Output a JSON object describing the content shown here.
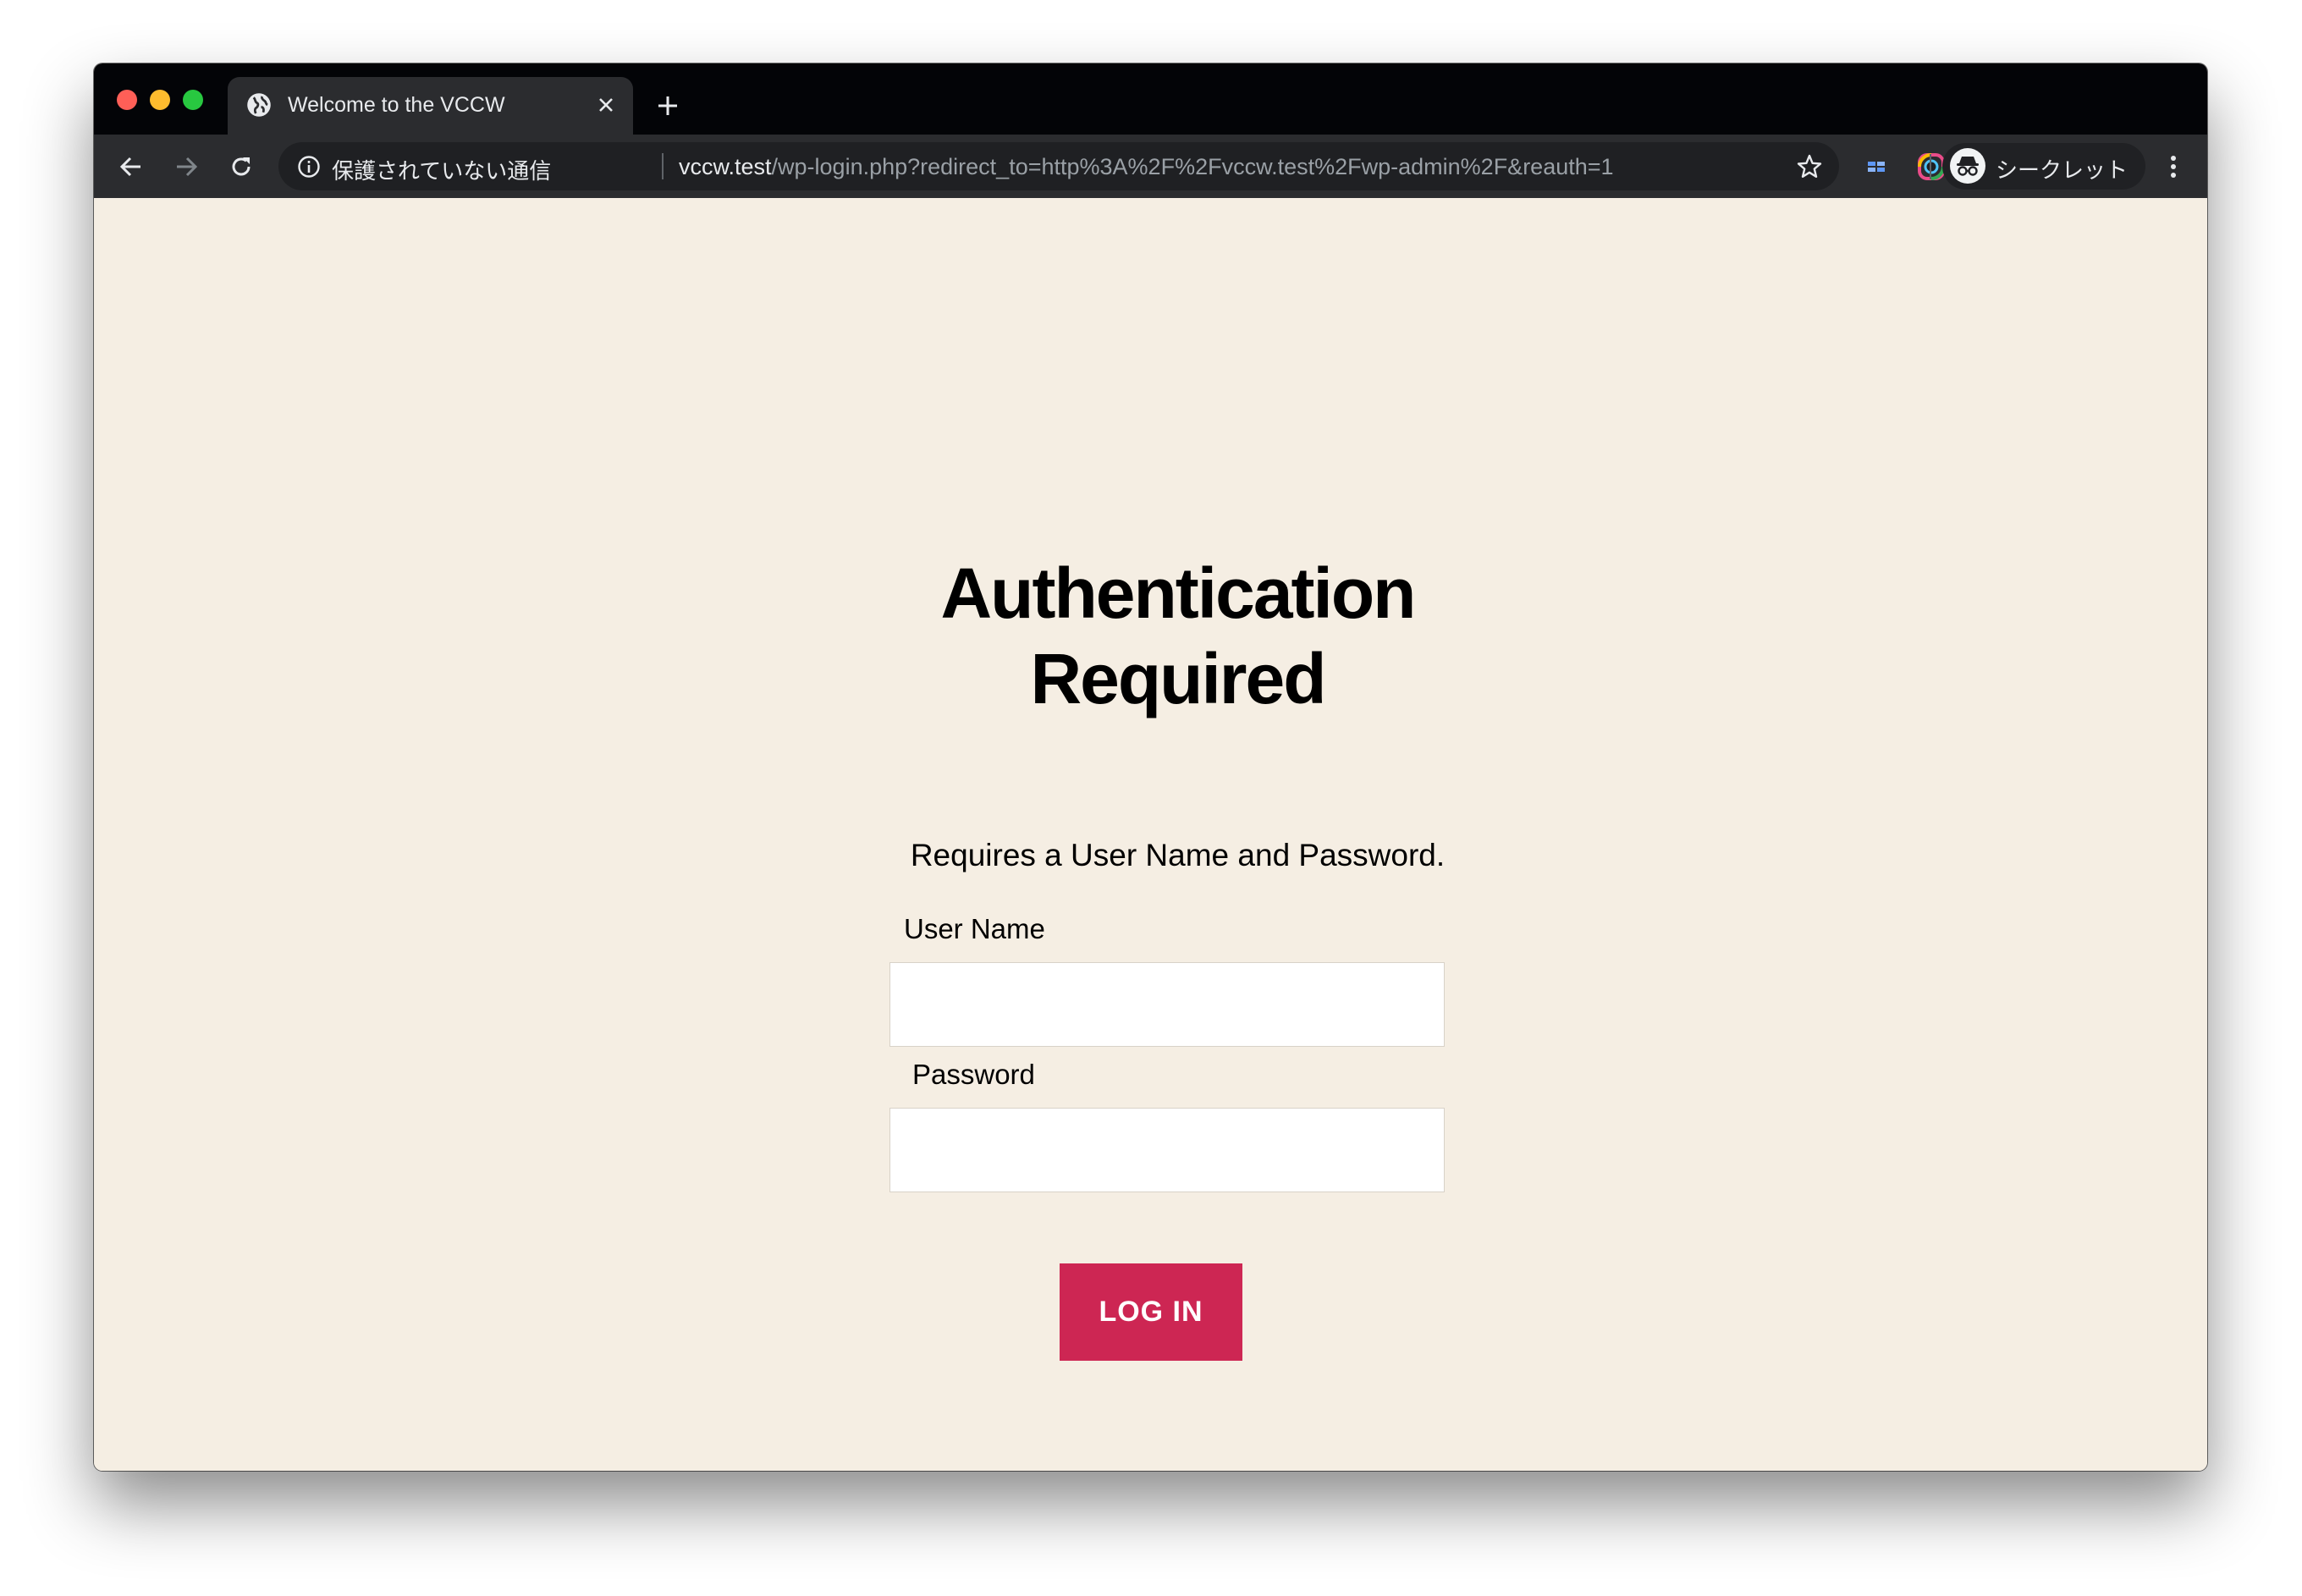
{
  "browser": {
    "tab": {
      "title": "Welcome to the VCCW",
      "favicon": "globe-icon",
      "close_icon": "close-icon"
    },
    "new_tab_icon": "plus-icon",
    "nav": {
      "back_icon": "arrow-left-icon",
      "forward_icon": "arrow-right-icon",
      "reload_icon": "reload-icon"
    },
    "omnibox": {
      "security_icon": "info-icon",
      "security_label": "保護されていない通信",
      "url_host": "vccw.test",
      "url_path": "/wp-login.php?redirect_to=http%3A%2F%2Fvccw.test%2Fwp-admin%2F&reauth=1",
      "bookmark_icon": "star-icon"
    },
    "extensions": [
      "grid-extension-icon",
      "color-ring-extension-icon",
      "cursor-extension-icon"
    ],
    "incognito": {
      "icon": "incognito-icon",
      "label": "シークレット"
    },
    "menu_icon": "kebab-menu-icon"
  },
  "page": {
    "heading_line1": "Authentication",
    "heading_line2": "Required",
    "subtitle": "Requires a User Name and Password.",
    "username_label": "User Name",
    "username_value": "",
    "password_label": "Password",
    "password_value": "",
    "login_button": "LOG IN"
  },
  "colors": {
    "page_background": "#f5eee3",
    "accent": "#cd2653",
    "tab_strip": "#030407",
    "toolbar": "#2b2c2f"
  }
}
